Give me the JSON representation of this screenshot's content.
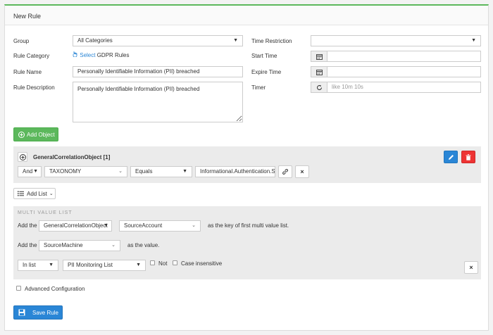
{
  "header": {
    "title": "New Rule"
  },
  "form": {
    "group_label": "Group",
    "group_value": "All Categories",
    "rule_category_label": "Rule Category",
    "select_link": "Select",
    "rule_category_value": "GDPR Rules",
    "rule_name_label": "Rule Name",
    "rule_name_value": "Personally Identifiable Information (PII) breached",
    "rule_description_label": "Rule Description",
    "rule_description_value": "Personally Identifiable Information (PII) breached",
    "time_restriction_label": "Time Restriction",
    "time_restriction_value": "",
    "start_time_label": "Start Time",
    "start_time_value": "",
    "expire_time_label": "Expire Time",
    "expire_time_value": "",
    "timer_label": "Timer",
    "timer_placeholder": "like 10m 10s"
  },
  "add_object_button": "Add Object",
  "object_block": {
    "title": "GeneralCorrelationObject [1]",
    "condition": {
      "logic": "And",
      "field": "TAXONOMY",
      "operator": "Equals",
      "value": "Informational.Authentication.S"
    }
  },
  "add_list_button": "Add List",
  "multi_value": {
    "heading": "MULTI VALUE LIST",
    "add_the_1": "Add the",
    "object_select": "GeneralCorrelationObject",
    "key_select": "SourceAccount",
    "key_suffix": "as the key of first multi value list.",
    "add_the_2": "Add the",
    "value_select": "SourceMachine",
    "value_suffix": "as the value.",
    "list_op": "In list",
    "list_name": "PII Monitoring List",
    "not_label": "Not",
    "case_label": "Case insensitive"
  },
  "advanced_label": "Advanced Configuration",
  "save_button": "Save Rule",
  "colors": {
    "accent_green": "#5cb85c",
    "primary_blue": "#2a86d6",
    "danger_red": "#e33333"
  }
}
